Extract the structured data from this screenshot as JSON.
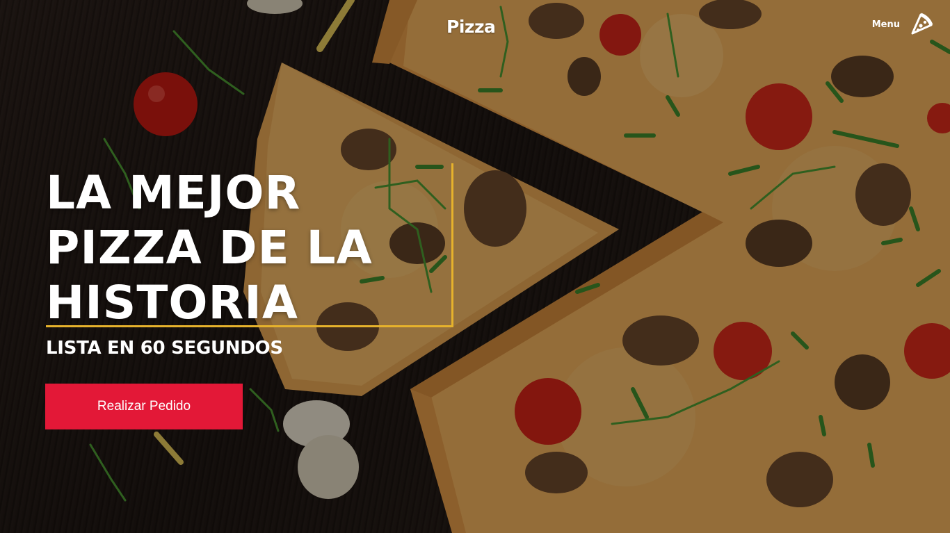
{
  "nav": {
    "brand": "Pizza",
    "menu_label": "Menu",
    "menu_icon": "pizza-slice-icon"
  },
  "hero": {
    "headline": "LA MEJOR PIZZA DE LA HISTORIA",
    "subline": "LISTA EN 60 SEGUNDOS",
    "cta_label": "Realizar Pedido",
    "background_image": "pizza-on-wooden-table"
  },
  "colors": {
    "accent_border": "#e6b22c",
    "cta_background": "#e31837",
    "text": "#ffffff"
  }
}
